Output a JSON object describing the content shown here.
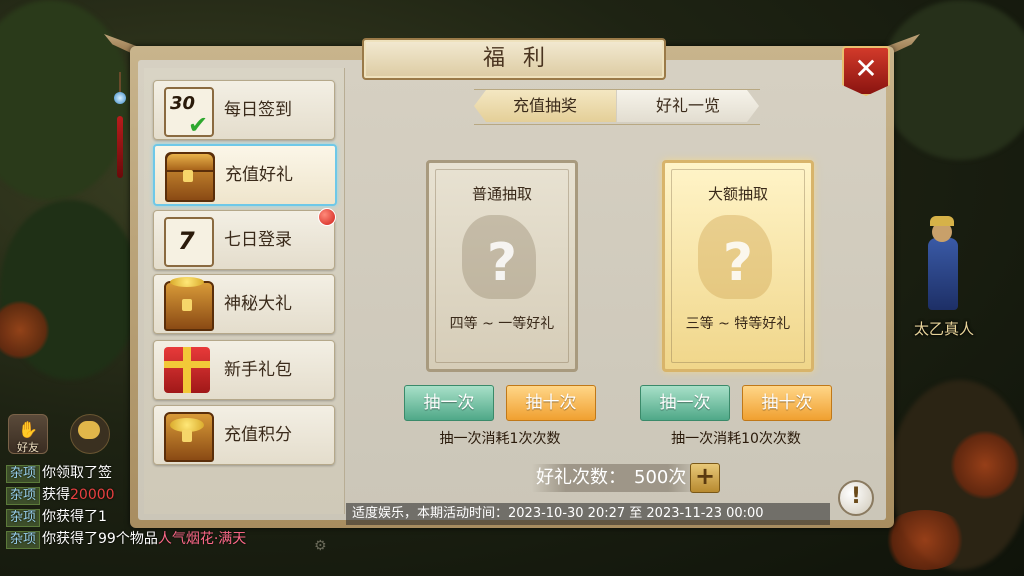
{
  "panel": {
    "title": "福利"
  },
  "menu": {
    "items": [
      {
        "label": "每日签到",
        "icon": "calendar-30-check-icon",
        "icon_text": "30"
      },
      {
        "label": "充值好礼",
        "icon": "treasure-chest-icon",
        "active": true
      },
      {
        "label": "七日登录",
        "icon": "calendar-7-icon",
        "icon_text": "7",
        "badge": "red-dot"
      },
      {
        "label": "神秘大礼",
        "icon": "gold-chest-icon"
      },
      {
        "label": "新手礼包",
        "icon": "red-gift-box-icon"
      },
      {
        "label": "充值积分",
        "icon": "gold-coin-chest-icon"
      }
    ]
  },
  "tabs": [
    {
      "label": "充值抽奖",
      "selected": true
    },
    {
      "label": "好礼一览",
      "selected": false
    }
  ],
  "cards": {
    "normal": {
      "title": "普通抽取",
      "reward_range": "四等 ~ 一等好礼",
      "mystery": "?"
    },
    "big": {
      "title": "大额抽取",
      "reward_range": "三等 ~ 特等好礼",
      "mystery": "?"
    }
  },
  "draw_buttons": {
    "once": "抽一次",
    "ten": "抽十次",
    "normal_cost": "抽一次消耗1次次数",
    "big_cost": "抽一次消耗10次次数"
  },
  "gift_count": {
    "label": "好礼次数：",
    "value": "500次"
  },
  "notice": "适度娱乐，本期活动时间：2023-10-30 20:27 至 2023-11-23 00:00",
  "npc": {
    "name": "太乙真人"
  },
  "social": {
    "friend_label": "好友"
  },
  "chat": {
    "tag": "杂项",
    "lines": [
      {
        "text": "你领取了签"
      },
      {
        "text": "获得",
        "highlight": "20000"
      },
      {
        "text": "你获得了1"
      },
      {
        "text": "你获得了99个物品",
        "highlight": "人气烟花·满天"
      }
    ]
  },
  "colors": {
    "active_border": "#6ec8e8",
    "close_red": "#d23a2a",
    "green_button": "#4fa888",
    "orange_button": "#f0a030",
    "chat_highlight_red": "#e84040",
    "chat_highlight_pink": "#ff6a8a"
  }
}
